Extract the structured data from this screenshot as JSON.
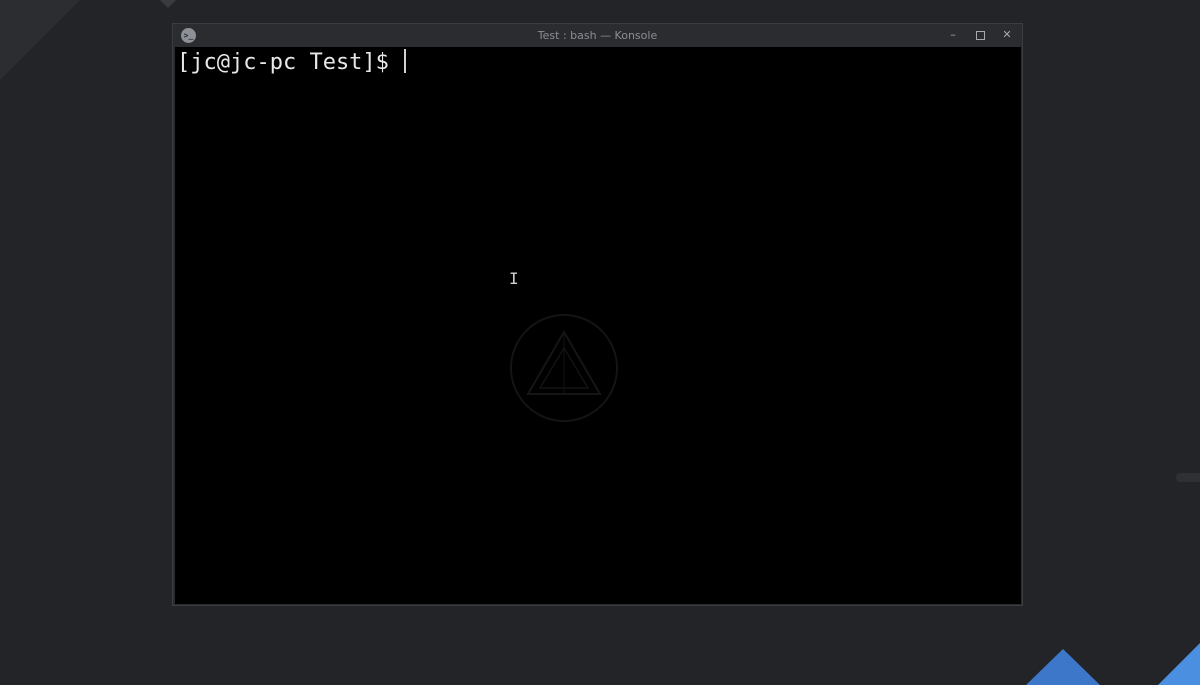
{
  "window": {
    "title": "Test : bash — Konsole",
    "app_icon": "konsole-terminal-icon",
    "buttons": {
      "minimize": "–",
      "maximize": "maximize-icon",
      "close": "✕"
    }
  },
  "terminal": {
    "prompt": "[jc@jc-pc Test]$ ",
    "background_color": "#000000",
    "text_color": "#e8e8e8"
  },
  "icons": {
    "app": "konsole-icon",
    "mouse_cursor": "text-cursor-icon",
    "watermark": "distro-logo-watermark"
  },
  "colors": {
    "desktop": "#232427",
    "accent_blue": "#3d77c9",
    "accent_blue_light": "#4a8fe0"
  }
}
